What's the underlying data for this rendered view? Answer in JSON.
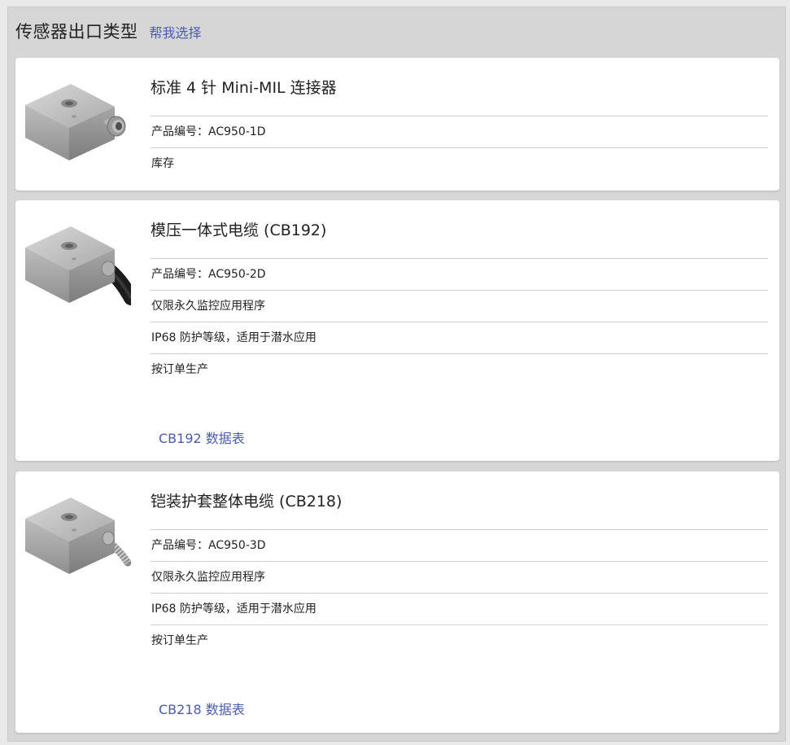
{
  "header": {
    "title": "传感器出口类型",
    "help_link": "帮我选择"
  },
  "products": [
    {
      "title": "标准 4 针 Mini-MIL 连接器",
      "specs": [
        "产品编号：AC950-1D",
        "库存"
      ],
      "datasheet": ""
    },
    {
      "title": "模压一体式电缆 (CB192)",
      "specs": [
        "产品编号：AC950-2D",
        "仅限永久监控应用程序",
        "IP68 防护等级，适用于潜水应用",
        "按订单生产"
      ],
      "datasheet": "CB192 数据表"
    },
    {
      "title": "铠装护套整体电缆 (CB218)",
      "specs": [
        "产品编号：AC950-3D",
        "仅限永久监控应用程序",
        "IP68 防护等级，适用于潜水应用",
        "按订单生产"
      ],
      "datasheet": "CB218 数据表"
    }
  ],
  "colors": {
    "link": "#4a5bb0",
    "panel_bg": "#d6d6d6",
    "card_bg": "#ffffff"
  },
  "icons": [
    "sensor-connector-image",
    "sensor-molded-cable-image",
    "sensor-armored-cable-image"
  ]
}
